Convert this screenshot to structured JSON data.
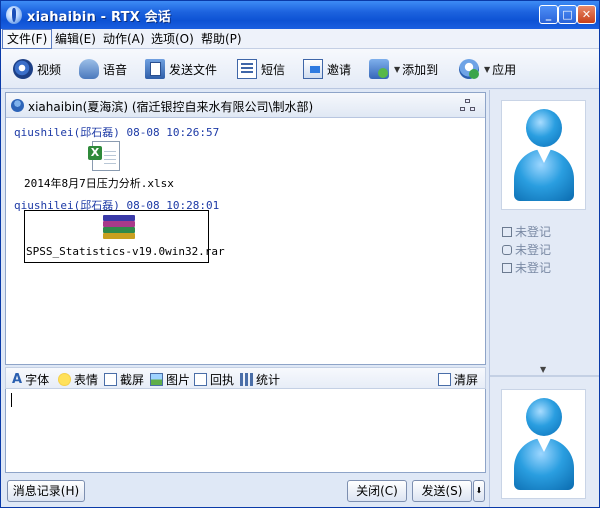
{
  "window": {
    "title": "xiahaibin - RTX 会话",
    "min_glyph": "_",
    "max_glyph": "□",
    "close_glyph": "✕"
  },
  "menu": [
    "文件(F)",
    "编辑(E)",
    "动作(A)",
    "选项(O)",
    "帮助(P)"
  ],
  "toolbar": {
    "video": "视频",
    "voice": "语音",
    "send_file": "发送文件",
    "sms": "短信",
    "invite": "邀请",
    "add_to": "添加到",
    "apps": "应用",
    "dropdown_glyph": "▼"
  },
  "chat": {
    "header": "xiahaibin(夏海滨) (宿迁银控自来水有限公司\\制水部)",
    "messages": [
      {
        "sender": "qiushilei(邱石磊)",
        "time": "08-08 10:26:57",
        "file": "2014年8月7日压力分析.xlsx"
      },
      {
        "sender": "qiushilei(邱石磊)",
        "time": "08-08 10:28:01",
        "file": "SPSS_Statistics-v19.0win32.rar"
      }
    ]
  },
  "contact": {
    "lines": [
      "未登记",
      "未登记",
      "未登记"
    ],
    "splitter_glyph": "▼"
  },
  "input_toolbar": {
    "font_glyph": "A",
    "font": "字体",
    "emoji": "表情",
    "screenshot": "截屏",
    "picture": "图片",
    "receipt": "回执",
    "stats": "统计",
    "clear": "清屏"
  },
  "buttons": {
    "history": "消息记录(H)",
    "close": "关闭(C)",
    "send": "发送(S)",
    "send_arrow": "⬇"
  }
}
